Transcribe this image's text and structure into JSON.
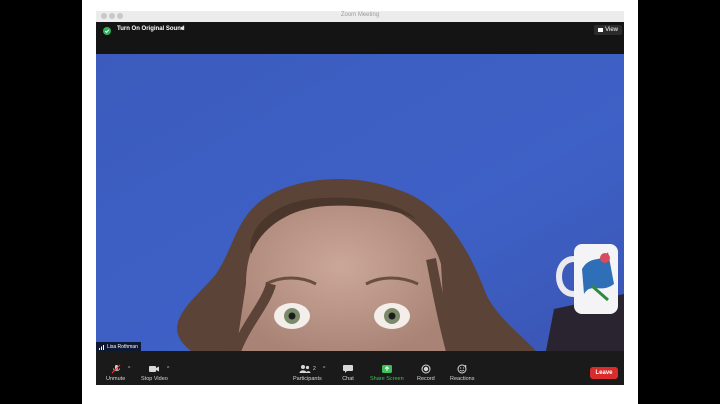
{
  "window": {
    "title": "Zoom Meeting"
  },
  "topbar": {
    "original_sound_label": "Turn On Original Sound",
    "view_label": "View"
  },
  "participant": {
    "name": "Lisa Rothman"
  },
  "toolbar": {
    "unmute_label": "Unmute",
    "stop_video_label": "Stop Video",
    "participants_label": "Participants",
    "participants_count": "2",
    "chat_label": "Chat",
    "share_screen_label": "Share Screen",
    "record_label": "Record",
    "reactions_label": "Reactions",
    "leave_label": "Leave"
  },
  "colors": {
    "wall": "#3d5dbf",
    "share_green": "#3cc15a",
    "leave_red": "#d92d2d",
    "toolbar_bg": "#1a1a1a"
  }
}
